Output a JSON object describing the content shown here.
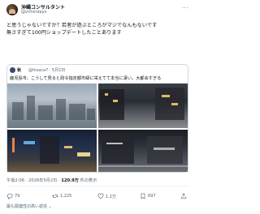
{
  "author": {
    "name": "沖縄コンサルタント",
    "handle": "@vrmindayo",
    "avatar_icon": "avatar-icon"
  },
  "tweet": {
    "lines": [
      "と思うじゃないですか？若者が遊ぶところがマジでなんもないです",
      "無さすぎて100円ショップデートしたことあります"
    ]
  },
  "quote": {
    "name": "秋",
    "handle": "@hisaca7",
    "date": "5月1日",
    "text": "鹿児島市、こうして見ると政令指定都市級に栄えてて本当に凄い。大都会すぎる"
  },
  "meta": {
    "time": "午後2:06 · 2026年5月2日 · ",
    "views_count": "120.9万",
    "views_label": " 件の表示"
  },
  "actions": {
    "reply": "79",
    "retweet": "1,225",
    "like": "1.2万",
    "bookmark": "697"
  },
  "footer": {
    "replies_label": "最も関連性の高い返信"
  },
  "colors": {
    "text": "#0f1419",
    "secondary": "#536471",
    "border": "#cfd9de"
  }
}
